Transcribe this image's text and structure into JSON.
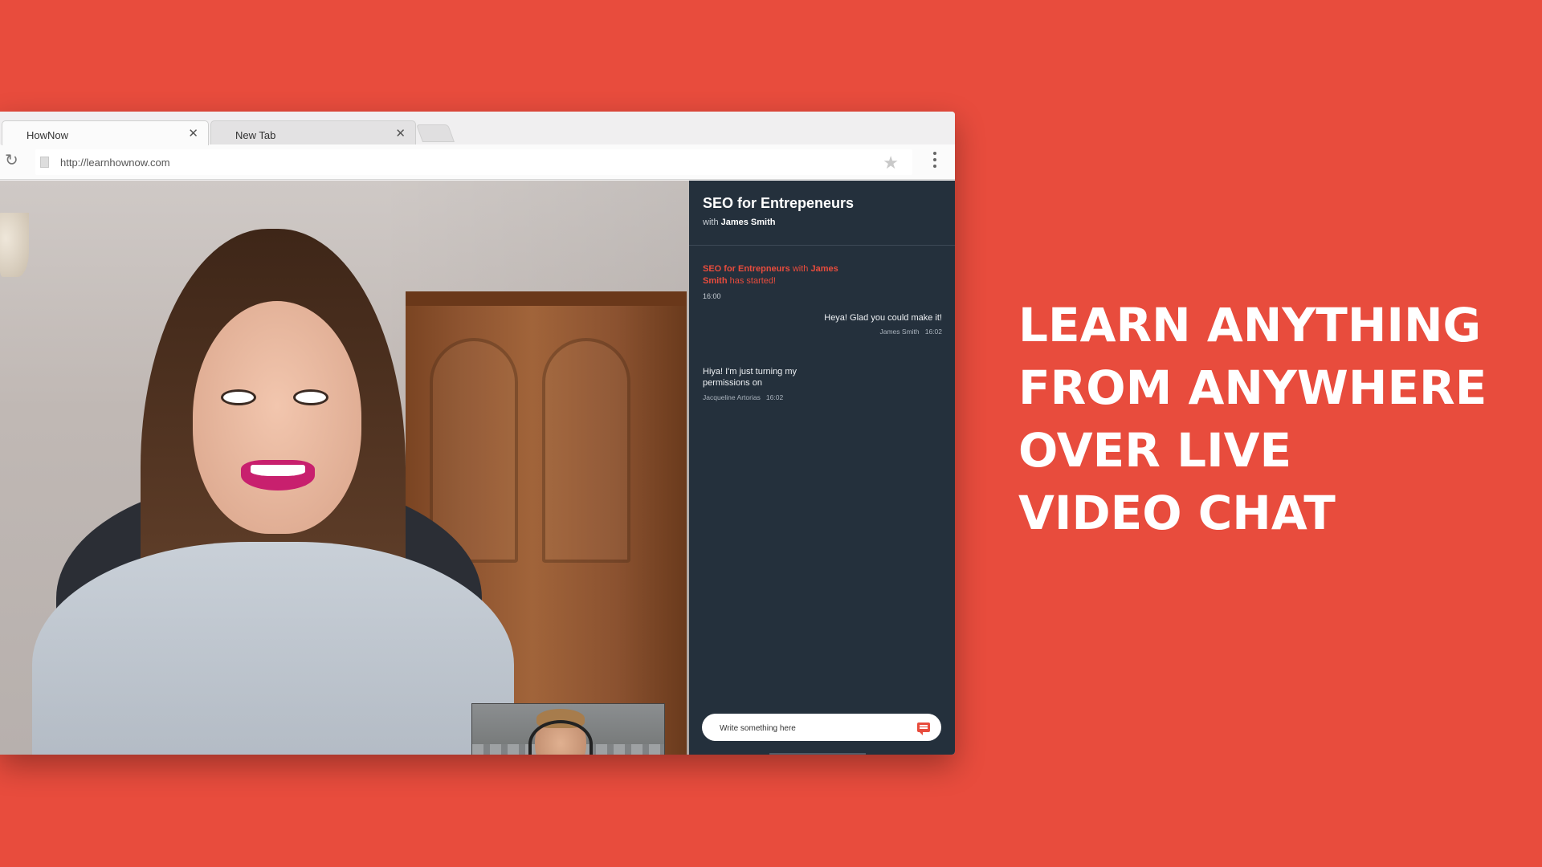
{
  "browser": {
    "tabs": [
      {
        "label": "HowNow",
        "active": true
      },
      {
        "label": "New Tab",
        "active": false
      }
    ],
    "url": "http://learnhownow.com"
  },
  "chat": {
    "title": "SEO for Entrepeneurs",
    "subtitle_prefix": "with",
    "subtitle_name": "James Smith",
    "system": {
      "course": "SEO for Entrepneurs",
      "with": "with",
      "host": "James Smith",
      "suffix": "has started!",
      "time": "16:00"
    },
    "messages": [
      {
        "text": "Heya! Glad you could make it!",
        "author": "James Smith",
        "time": "16:02",
        "align": "right"
      },
      {
        "text": "Hiya! I'm just turning my permissions on",
        "author": "Jacqueline Artorias",
        "time": "16:02",
        "align": "left"
      }
    ],
    "input_placeholder": "Write something here"
  },
  "headline": {
    "lines": [
      "LEARN ANYTHING",
      "FROM ANYWHERE",
      "OVER LIVE",
      "VIDEO CHAT"
    ]
  },
  "colors": {
    "background": "#e84c3d",
    "chat_panel": "#24303c",
    "end_call": "#e72b2b"
  },
  "icons": [
    "reload-icon",
    "page-icon",
    "star-icon",
    "menu-icon",
    "mic-icon",
    "camera-icon",
    "screen-share-icon",
    "end-call-icon",
    "send-icon",
    "close-icon"
  ]
}
